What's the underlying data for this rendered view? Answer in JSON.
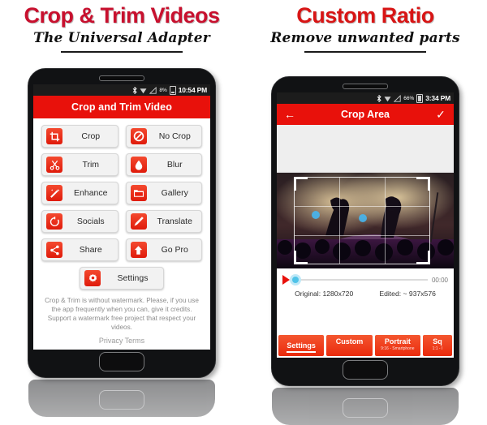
{
  "left": {
    "title": "Crop & Trim Videos",
    "subtitle": "The Universal Adapter",
    "status": {
      "battery": "8%",
      "time": "10:54 PM"
    },
    "appbar_title": "Crop and Trim Video",
    "buttons": [
      {
        "label": "Crop",
        "icon": "crop-icon"
      },
      {
        "label": "No Crop",
        "icon": "no-crop-icon"
      },
      {
        "label": "Trim",
        "icon": "scissors-icon"
      },
      {
        "label": "Blur",
        "icon": "droplet-icon"
      },
      {
        "label": "Enhance",
        "icon": "magic-wand-icon"
      },
      {
        "label": "Gallery",
        "icon": "folder-icon"
      },
      {
        "label": "Socials",
        "icon": "refresh-circle-icon"
      },
      {
        "label": "Translate",
        "icon": "pencil-icon"
      },
      {
        "label": "Share",
        "icon": "share-icon"
      },
      {
        "label": "Go Pro",
        "icon": "up-arrow-icon"
      }
    ],
    "settings_label": "Settings",
    "note": "Crop & Trim is without watermark. Please, if you use the app frequently when you can, give it credits. Support a watermark free project that respect your videos.",
    "privacy": "Privacy Terms"
  },
  "right": {
    "title": "Custom Ratio",
    "subtitle": "Remove unwanted parts",
    "status": {
      "battery": "66%",
      "time": "3:34 PM"
    },
    "appbar_title": "Crop Area",
    "back_icon": "back-arrow-icon",
    "confirm_icon": "checkmark-icon",
    "timecode": "00:00",
    "original": "Original: 1280x720",
    "edited": "Edited: ~ 937x576",
    "tabs": [
      {
        "label": "Settings",
        "sub": ""
      },
      {
        "label": "Custom",
        "sub": ""
      },
      {
        "label": "Portrait",
        "sub": "9:16 - Smartphone"
      },
      {
        "label": "Sq",
        "sub": "1:1 - I"
      }
    ]
  },
  "colors": {
    "brand_red": "#e8110b",
    "title_red": "#c8102e",
    "slider_blue": "#4fc3e8"
  }
}
